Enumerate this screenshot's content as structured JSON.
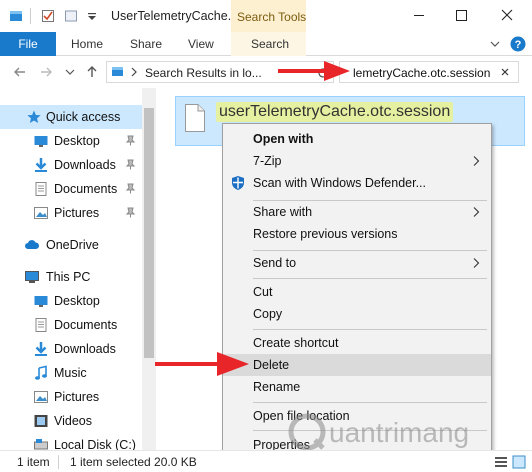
{
  "window": {
    "title": "UserTelemetryCache...",
    "contextual_tab": "Search Tools"
  },
  "ribbon": {
    "file_tab": "File",
    "tabs": [
      "Home",
      "Share",
      "View",
      "Search"
    ]
  },
  "address_bar": {
    "path": "Search Results in lo...",
    "search_value": "lemetryCache.otc.session"
  },
  "sidebar": {
    "items": [
      {
        "label": "Quick access",
        "icon": "star-icon"
      },
      {
        "label": "Desktop",
        "icon": "desktop-icon"
      },
      {
        "label": "Downloads",
        "icon": "download-icon"
      },
      {
        "label": "Documents",
        "icon": "documents-icon"
      },
      {
        "label": "Pictures",
        "icon": "pictures-icon"
      },
      {
        "label": "OneDrive",
        "icon": "cloud-icon"
      },
      {
        "label": "This PC",
        "icon": "computer-icon"
      },
      {
        "label": "Desktop",
        "icon": "desktop-icon"
      },
      {
        "label": "Documents",
        "icon": "documents-icon"
      },
      {
        "label": "Downloads",
        "icon": "download-icon"
      },
      {
        "label": "Music",
        "icon": "music-icon"
      },
      {
        "label": "Pictures",
        "icon": "pictures-icon"
      },
      {
        "label": "Videos",
        "icon": "video-icon"
      },
      {
        "label": "Local Disk (C:)",
        "icon": "disk-icon"
      }
    ]
  },
  "file": {
    "name": "userTelemetryCache.otc.session"
  },
  "context_menu": {
    "items": [
      "Open with",
      "7-Zip",
      "Scan with Windows Defender...",
      "Share with",
      "Restore previous versions",
      "Send to",
      "Cut",
      "Copy",
      "Create shortcut",
      "Delete",
      "Rename",
      "Open file location",
      "Properties"
    ]
  },
  "status_bar": {
    "count": "1 item",
    "selection": "1 item selected  20.0 KB"
  },
  "watermark": {
    "text": "uantrimang"
  },
  "colors": {
    "accent": "#1979ca",
    "selection": "#cce8ff",
    "search_tools": "#fdf0d0",
    "annotation_red": "#e8262a"
  }
}
